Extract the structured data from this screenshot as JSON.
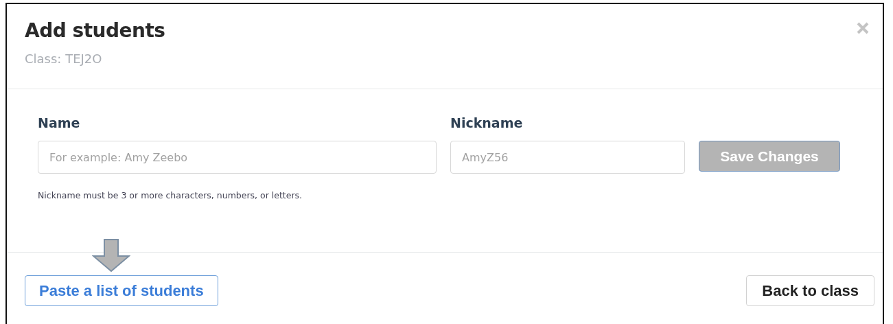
{
  "dialog": {
    "title": "Add students",
    "subtitle": "Class: TEJ2O"
  },
  "fields": [
    {
      "label": "Name",
      "placeholder": "For example: Amy Zeebo"
    },
    {
      "label": "Nickname",
      "placeholder": "AmyZ56"
    }
  ],
  "save_button": {
    "label": "Save Changes",
    "disabled": true
  },
  "hint": "Nickname must be 3 or more characters, numbers, or letters.",
  "footer": {
    "paste_button": "Paste a list of students",
    "back_button": "Back to class"
  }
}
